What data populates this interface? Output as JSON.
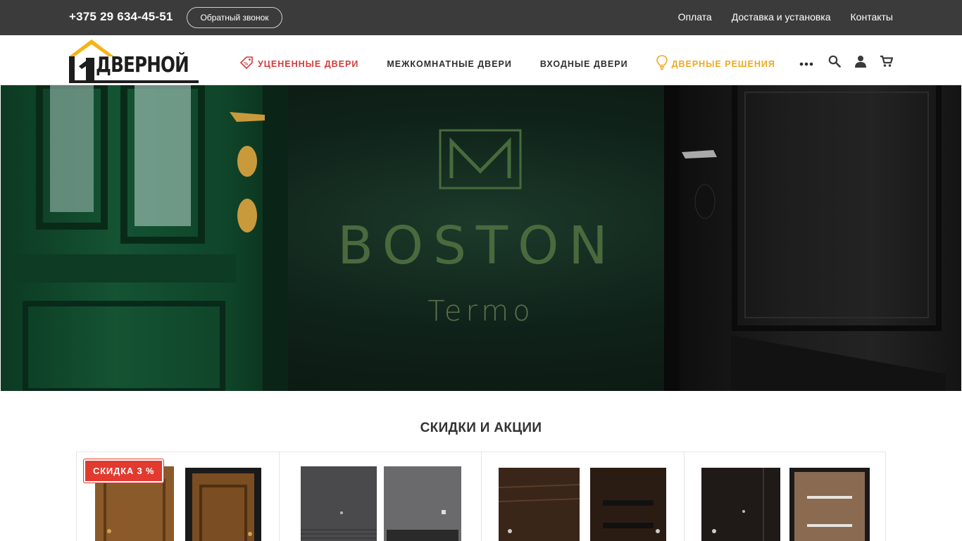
{
  "topbar": {
    "phone": "+375 29 634-45-51",
    "callback_label": "Обратный звонок",
    "links": [
      "Оплата",
      "Доставка и установка",
      "Контакты"
    ]
  },
  "header": {
    "logo_text": "ДВЕРНОЙ",
    "logo_number": "1",
    "nav": [
      {
        "label": "УЦЕНЕННЫЕ ДВЕРИ",
        "icon": "discount-tag-icon",
        "color": "#d23b3b"
      },
      {
        "label": "МЕЖКОМНАТНЫЕ ДВЕРИ"
      },
      {
        "label": "ВХОДНЫЕ ДВЕРИ"
      },
      {
        "label": "ДВЕРНЫЕ РЕШЕНИЯ",
        "icon": "lightbulb-icon",
        "color": "#f0a820"
      }
    ],
    "icons": [
      "more-dots-icon",
      "search-icon",
      "user-icon",
      "cart-icon"
    ]
  },
  "hero": {
    "title": "BOSTON",
    "subtitle": "Termo"
  },
  "section": {
    "title": "СКИДКИ И АКЦИИ"
  },
  "products": [
    {
      "badge": "СКИДКА 3 %",
      "colors": [
        "#8a5a2b",
        "#7a4d22"
      ]
    },
    {
      "colors": [
        "#4a4a4c",
        "#6a6a6c"
      ]
    },
    {
      "colors": [
        "#3a2519",
        "#2b1c13"
      ]
    },
    {
      "colors": [
        "#1f1a17",
        "#8b6a52"
      ]
    }
  ],
  "colors": {
    "topbar_bg": "#3b3b3b",
    "accent_red": "#d23b3b",
    "accent_orange": "#f0a820"
  }
}
